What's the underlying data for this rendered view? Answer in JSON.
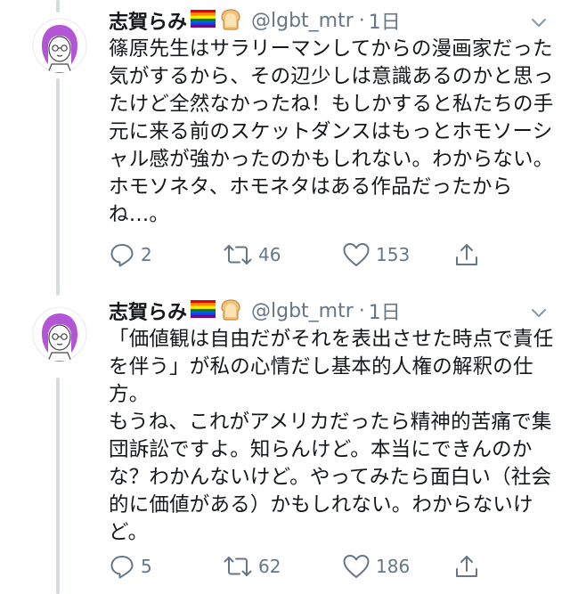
{
  "tweets": [
    {
      "name": "志賀らみ",
      "handle": "@lgbt_mtr",
      "separator": "·",
      "time": "1日",
      "text": "篠原先生はサラリーマンしてからの漫画家だった気がするから、その辺少しは意識あるのかと思ったけど全然なかったね！もしかすると私たちの手元に来る前のスケットダンスはもっとホモソーシャル感が強かったのかもしれない。わからない。ホモソネタ、ホモネタはある作品だったからね…。",
      "replies": "2",
      "retweets": "46",
      "likes": "153"
    },
    {
      "name": "志賀らみ",
      "handle": "@lgbt_mtr",
      "separator": "·",
      "time": "1日",
      "text": "「価値観は自由だがそれを表出させた時点で責任を伴う」が私の心情だし基本的人権の解釈の仕方。\nもうね、これがアメリカだったら精神的苦痛で集団訴訟ですよ。知らんけど。本当にできんのかな？わかんないけど。やってみたら面白い（社会的に価値がある）かもしれない。わからないけど。",
      "replies": "5",
      "retweets": "62",
      "likes": "186"
    }
  ],
  "icons": {
    "rainbow_flag": "rainbow-flag-icon",
    "bread": "bread-icon",
    "caret": "chevron-down-icon",
    "reply": "reply-icon",
    "retweet": "retweet-icon",
    "like": "heart-icon",
    "share": "share-icon"
  },
  "colors": {
    "text": "#14171a",
    "secondary": "#657786",
    "thread_line": "#d6dbe0"
  }
}
